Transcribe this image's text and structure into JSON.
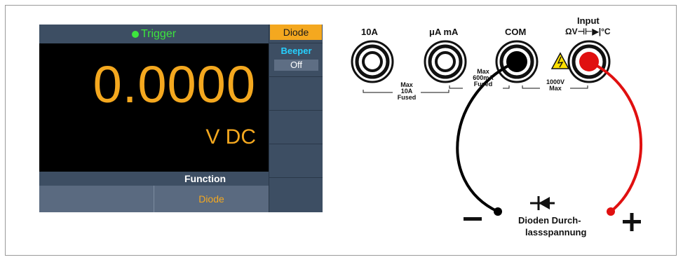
{
  "screen": {
    "status": "Trigger",
    "reading": "0.0000",
    "unit": "V DC",
    "function_label": "Function",
    "softkeys": [
      "",
      "Diode"
    ],
    "side": {
      "tab": "Diode",
      "beeper_label": "Beeper",
      "beeper_value": "Off"
    }
  },
  "panel": {
    "terminals": {
      "t10a": "10A",
      "tuama": "μA mA",
      "com": "COM",
      "input": "Input",
      "input_symbols": "ΩV⊣⊢▶|°C"
    },
    "ratings": {
      "max10a": [
        "Max",
        "10A",
        "Fused"
      ],
      "max600": [
        "Max",
        "600mA",
        "Fused"
      ],
      "max1000": [
        "1000V",
        "Max"
      ]
    },
    "caption": [
      "Dioden Durch-",
      "lassspannung"
    ],
    "minus": "–",
    "plus": "+"
  },
  "colors": {
    "screen_bg": "#3d4e63",
    "reading": "#f4a81f",
    "trigger": "#3de63d",
    "beeper": "#26d0ff",
    "probe_red": "#e01010",
    "probe_black": "#000000"
  }
}
